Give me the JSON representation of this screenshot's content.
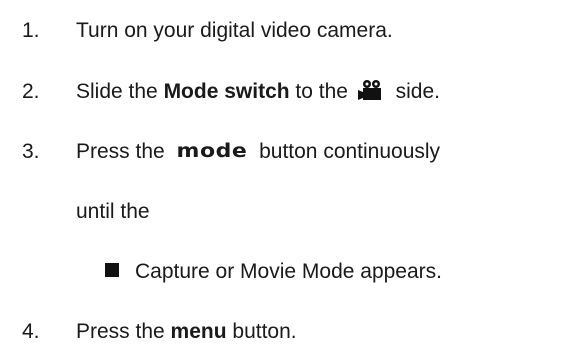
{
  "steps": [
    {
      "number": "1.",
      "text": "Turn on your digital video camera."
    },
    {
      "number": "2.",
      "prefix": "Slide the ",
      "bold": "Mode switch",
      "middle": " to the ",
      "icon": "video-camera-icon",
      "suffix": " side."
    },
    {
      "number": "3.",
      "prefix": "Press the ",
      "button_label": "mode",
      "suffix": " button continuously",
      "continuation": "until the"
    },
    {
      "bullet_text": "Capture or Movie Mode appears."
    },
    {
      "number": "4.",
      "prefix": "Press the ",
      "bold": "menu",
      "suffix": " button."
    }
  ]
}
